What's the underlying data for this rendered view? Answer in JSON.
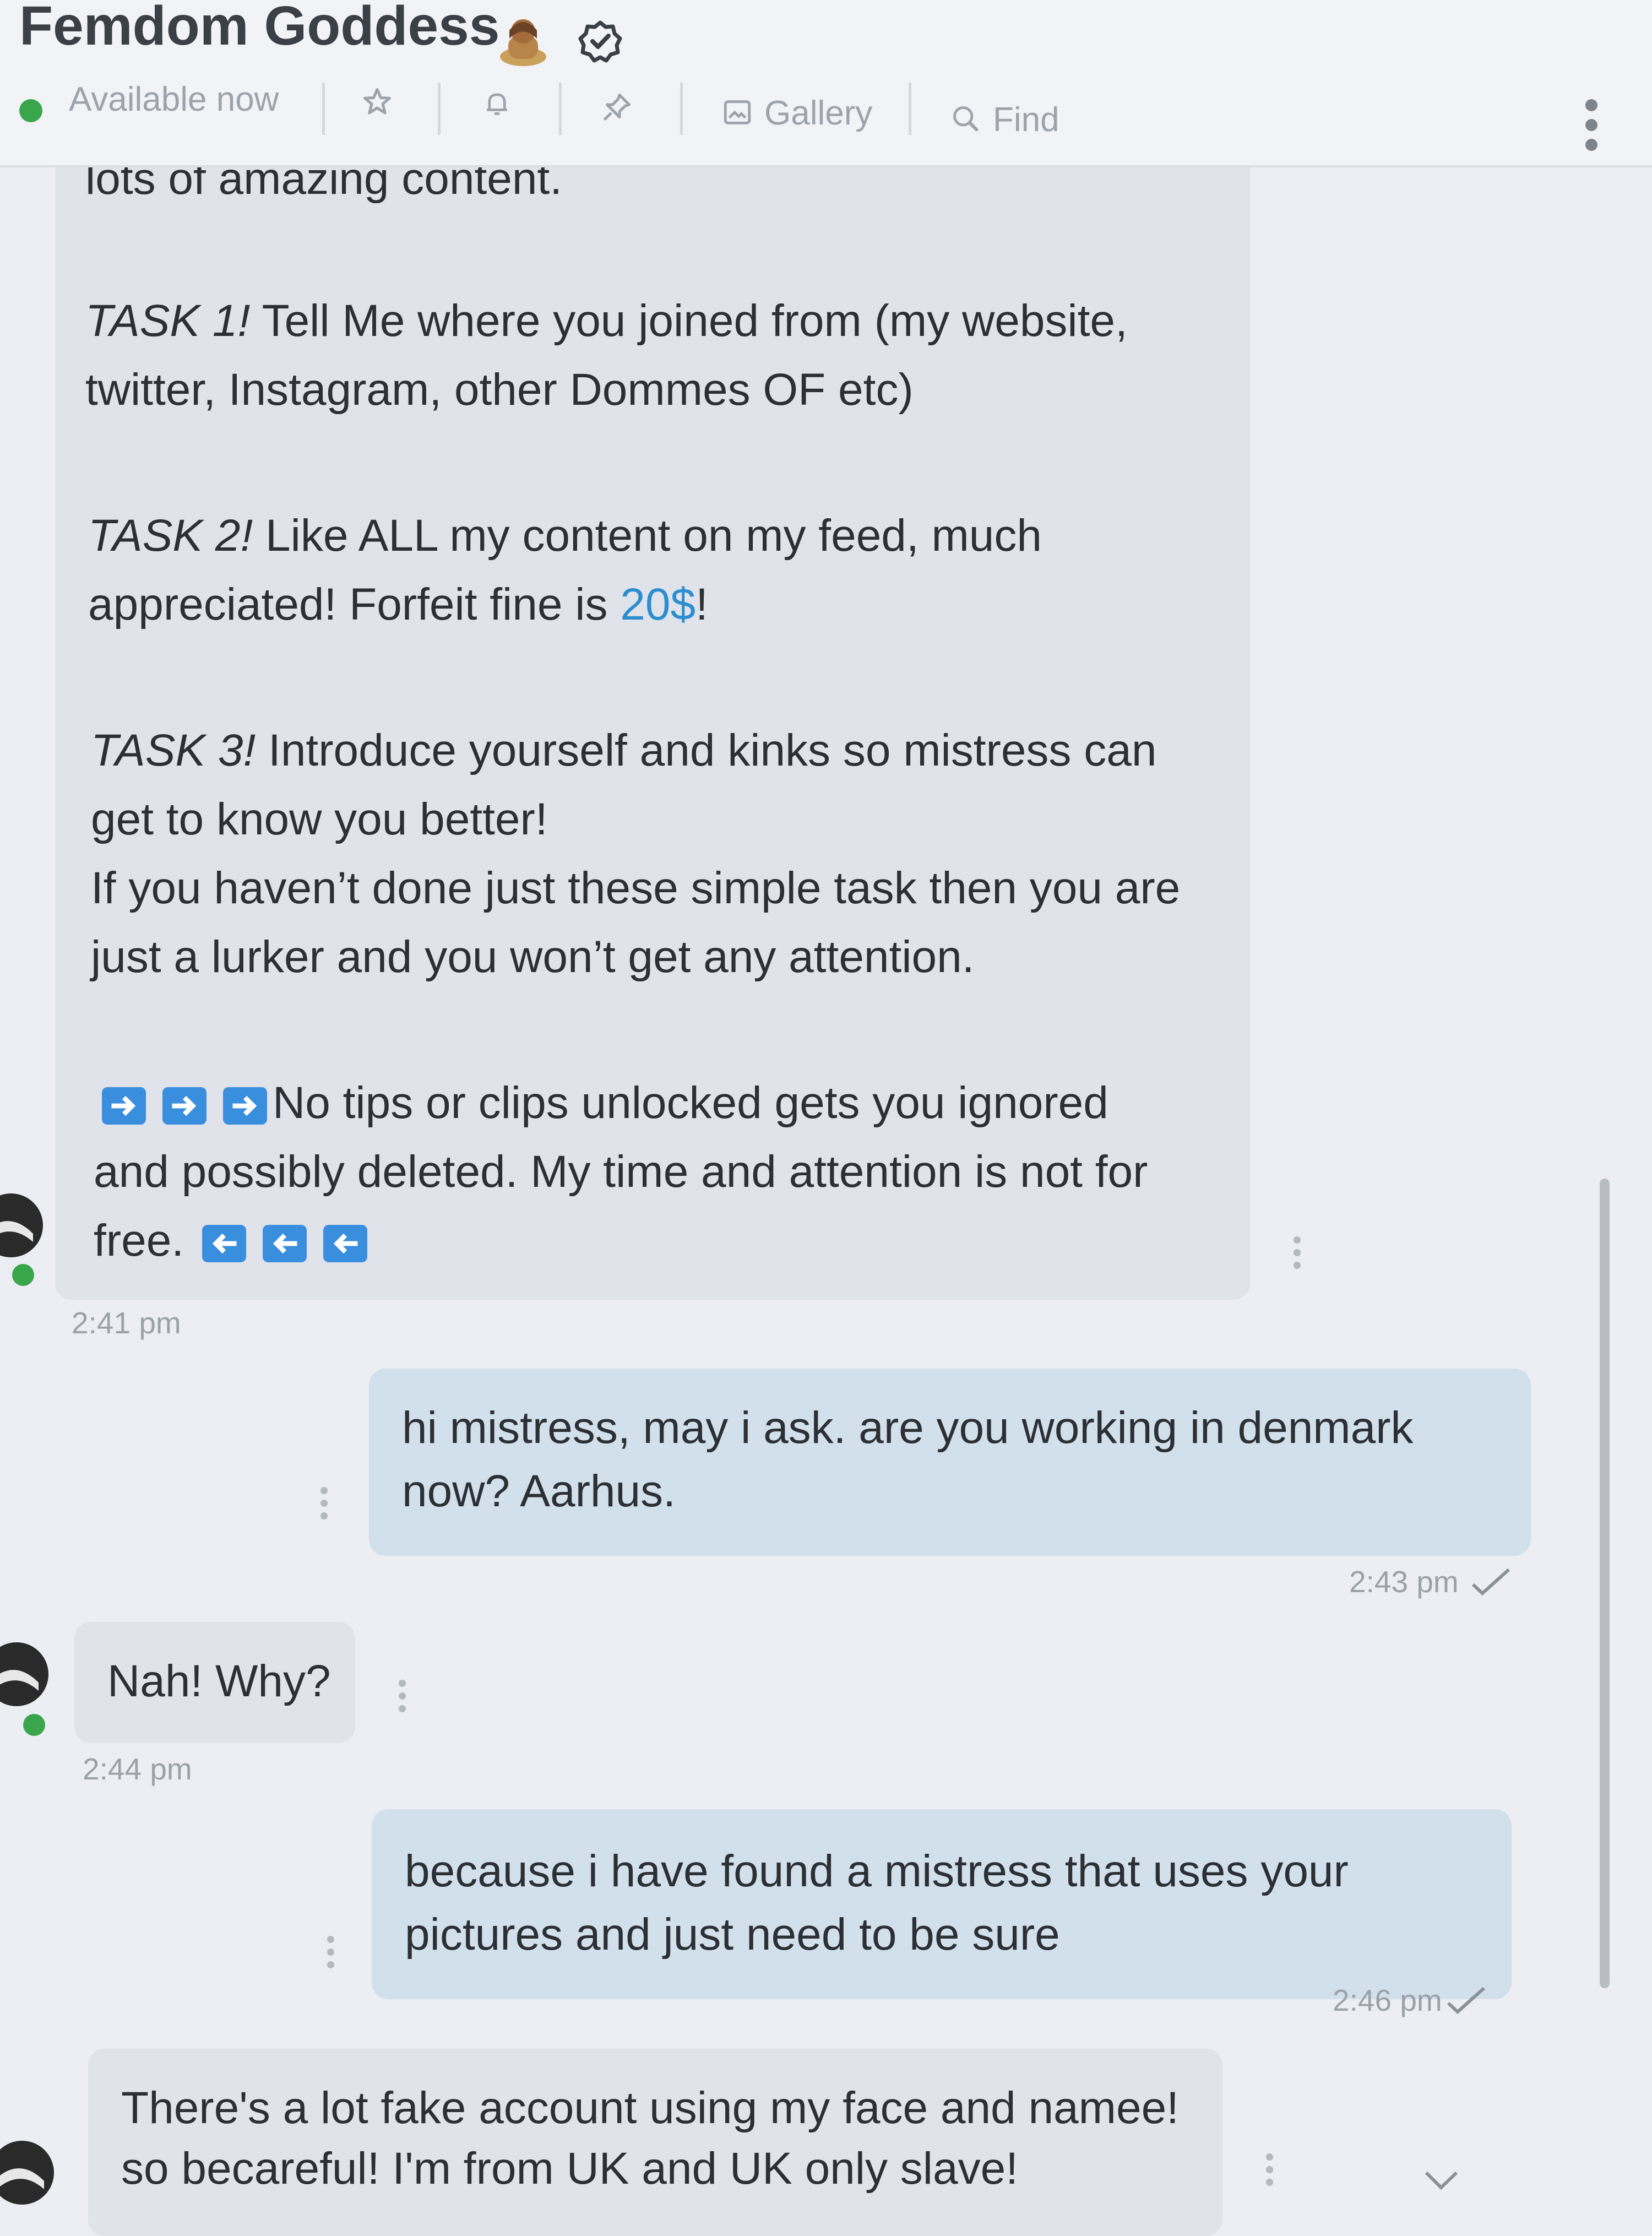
{
  "header": {
    "title": "Femdom Goddess",
    "title_emoji": "woman-emoji",
    "status": "Available now",
    "toolbar": {
      "gallery_label": "Gallery",
      "find_label": "Find"
    }
  },
  "messages": [
    {
      "direction": "incoming",
      "partial_top": "lots of amazing content.",
      "tasks": [
        {
          "label": "TASK 1!",
          "line1": " Tell Me where you joined from (my website,",
          "line2": "twitter, Instagram, other Dommes OF etc)"
        },
        {
          "label": "TASK 2!",
          "line1": " Like ALL my content on my feed, much",
          "line2_before": "appreciated! Forfeit fine is ",
          "line2_price": "20$",
          "line2_after": "!"
        },
        {
          "label": "TASK 3!",
          "line1": " Introduce yourself and kinks so mistress can",
          "line2": "get to know you better!"
        }
      ],
      "lurker_line1": "If you haven’t done just these simple task then you are",
      "lurker_line2": "just a lurker and you won’t get any attention.",
      "warning_line1": "No tips or clips unlocked gets you ignored",
      "warning_line2": "and possibly deleted. My time and attention is not for",
      "warning_line3": "free.",
      "time": "2:41 pm"
    },
    {
      "direction": "outgoing",
      "line1": "hi mistress, may i ask. are you working in denmark",
      "line2": "now? Aarhus.",
      "time": "2:43 pm"
    },
    {
      "direction": "incoming",
      "line1": "Nah! Why?",
      "time": "2:44 pm"
    },
    {
      "direction": "outgoing",
      "line1": "because i have found a mistress that uses your",
      "line2": "pictures and just need to be sure",
      "time": "2:46 pm"
    },
    {
      "direction": "incoming",
      "line1": "There's a lot fake account using my face and namee!",
      "line2": "so becareful! I'm from UK and UK only slave!"
    }
  ],
  "colors": {
    "incoming_bubble": "#e0e3e9",
    "outgoing_bubble": "#d2e0ec",
    "price_link": "#2c8ed1",
    "online": "#3aa64c",
    "arrow_emoji": "#3a8ede"
  }
}
